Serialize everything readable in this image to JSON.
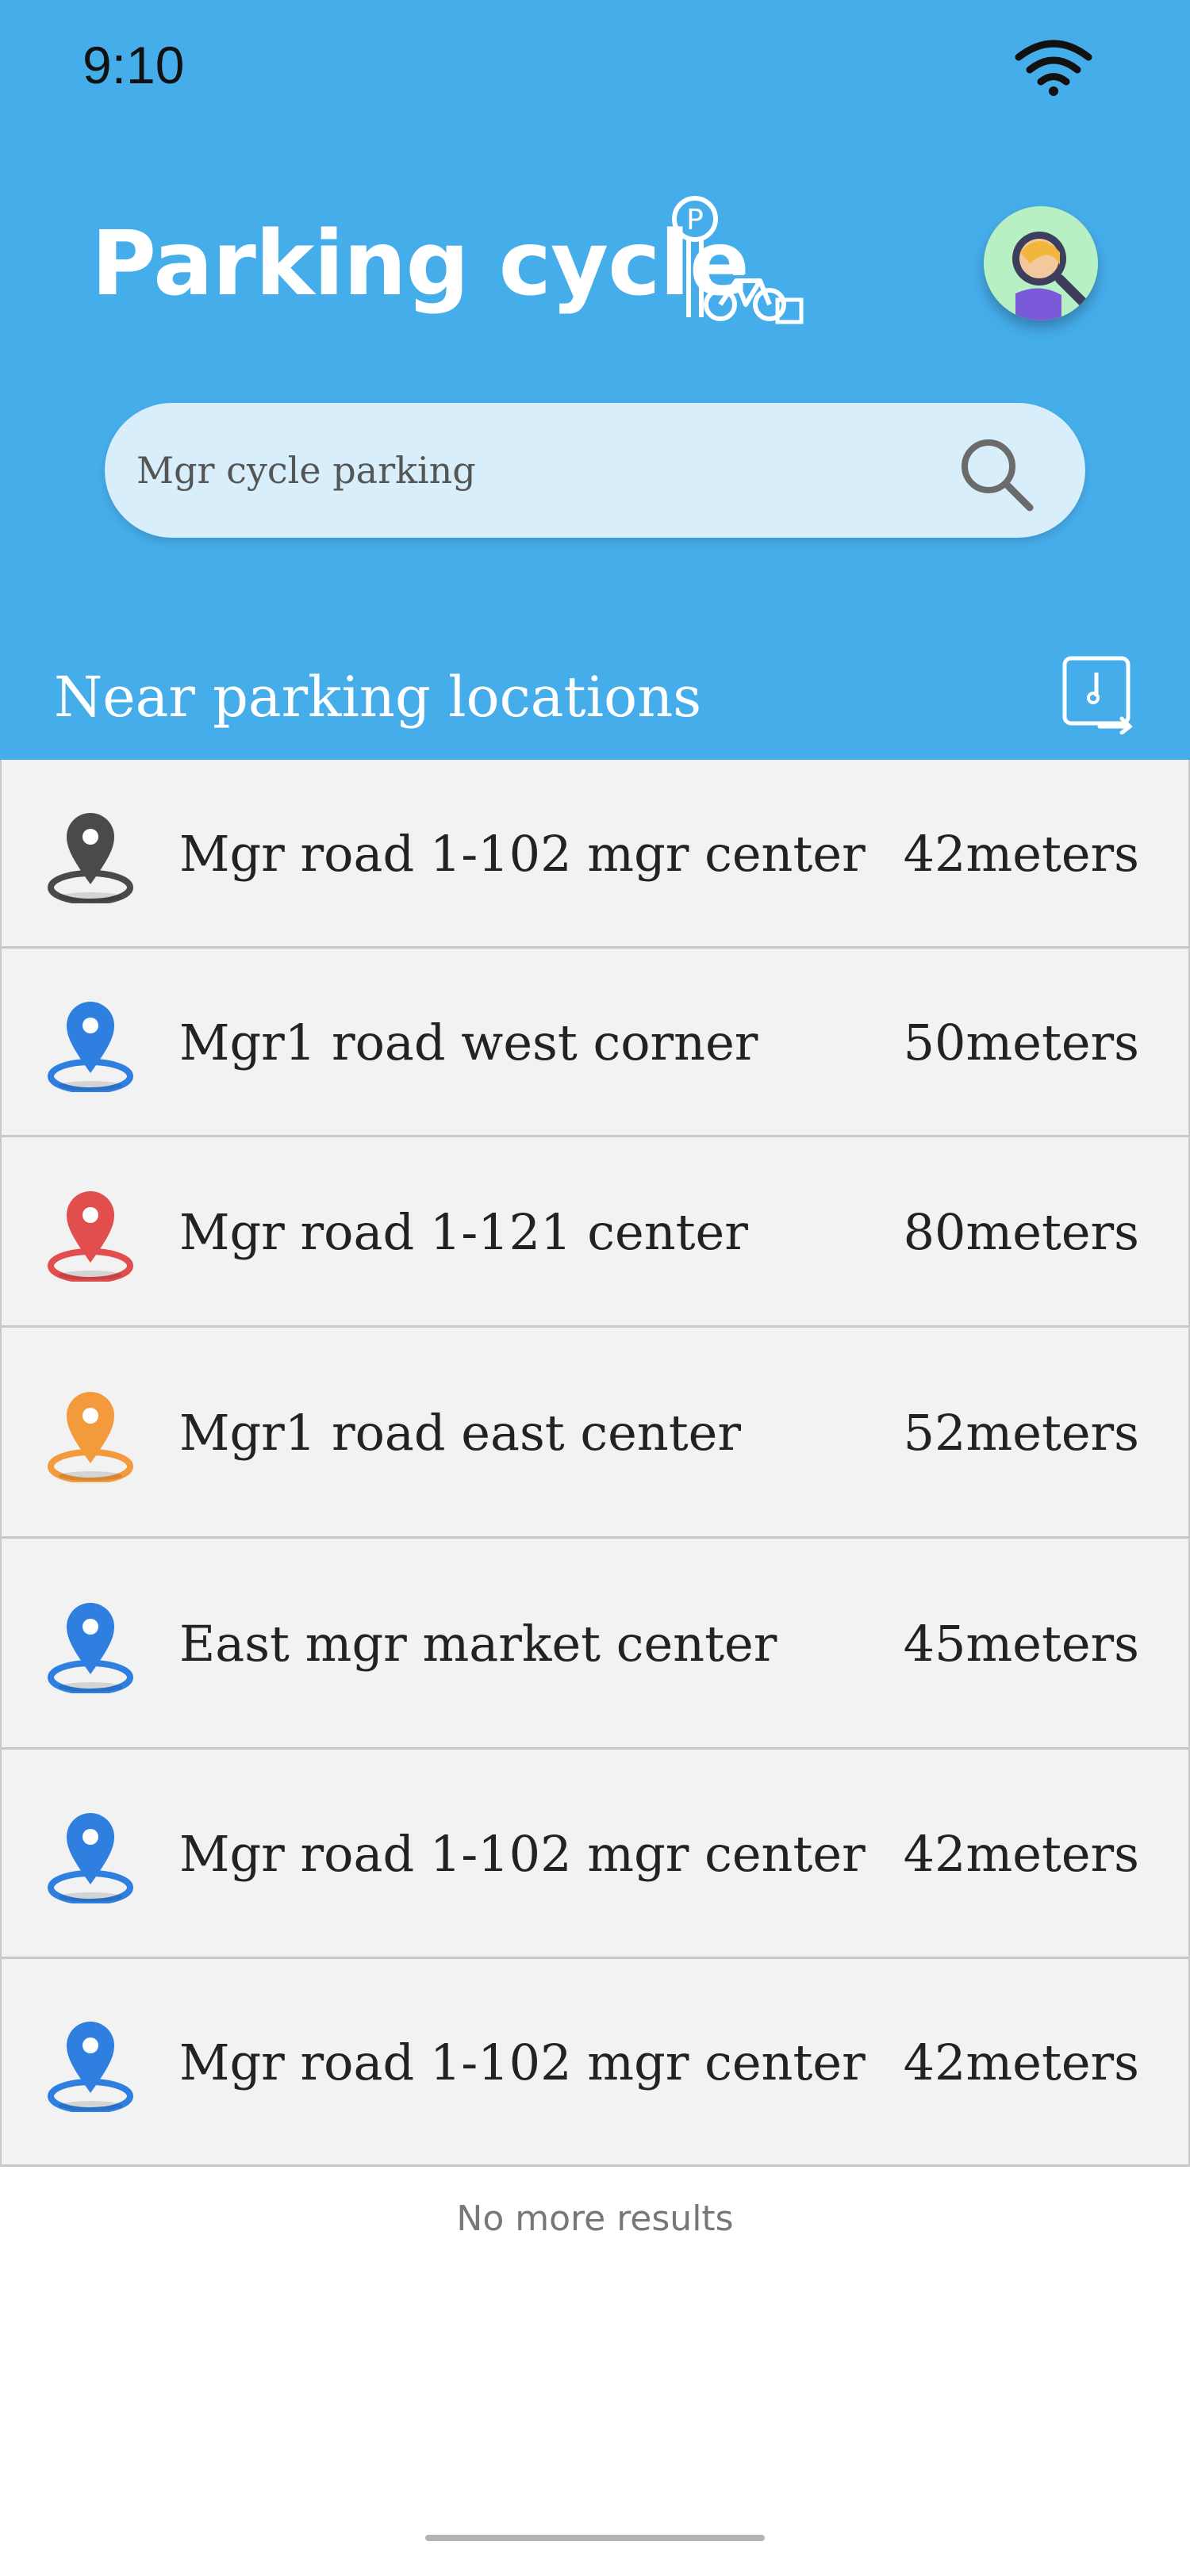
{
  "status_bar": {
    "time": "9:10"
  },
  "header": {
    "title": "Parking cycle",
    "logo_icon": "parking-bicycle-icon",
    "avatar_icon": "user-avatar-icon"
  },
  "search": {
    "placeholder": "Mgr cycle parking",
    "icon": "search-icon"
  },
  "section": {
    "title": "Near parking locations",
    "sort_icon": "sort-icon"
  },
  "colors": {
    "header_bg": "#46adeb",
    "pin_black": "#4a4a4a",
    "pin_blue": "#2f7fe0",
    "pin_red": "#e24e4e",
    "pin_orange": "#f29a3c"
  },
  "locations": [
    {
      "name": "Mgr road 1-102 mgr center",
      "distance": "42meters",
      "pin_color": "#4a4a4a"
    },
    {
      "name": "Mgr1 road west corner",
      "distance": "50meters",
      "pin_color": "#2f7fe0"
    },
    {
      "name": "Mgr road 1-121 center",
      "distance": "80meters",
      "pin_color": "#e24e4e"
    },
    {
      "name": "Mgr1 road east center",
      "distance": "52meters",
      "pin_color": "#f29a3c"
    },
    {
      "name": "East mgr market center",
      "distance": "45meters",
      "pin_color": "#2f7fe0"
    },
    {
      "name": "Mgr road 1-102 mgr center",
      "distance": "42meters",
      "pin_color": "#2f7fe0"
    },
    {
      "name": "Mgr road 1-102 mgr center",
      "distance": "42meters",
      "pin_color": "#2f7fe0"
    }
  ],
  "footer": {
    "no_more": "No more results"
  }
}
